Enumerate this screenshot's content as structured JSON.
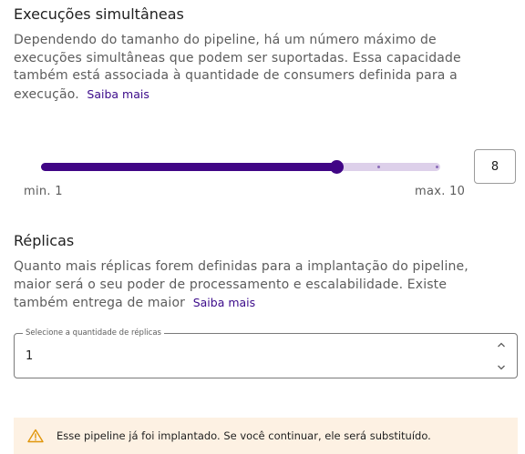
{
  "concurrency": {
    "title": "Execuções simultâneas",
    "description": "Dependendo do tamanho do pipeline, há um número máximo de execuções simultâneas que podem ser suportadas. Essa capacidade também está associada à quantidade de consumers definida para a execução.",
    "learn_more": "Saiba mais",
    "slider": {
      "min_label": "min. 1",
      "max_label": "max. 10",
      "min": 1,
      "max": 10,
      "value": 8
    },
    "value_input": "8"
  },
  "replicas": {
    "title": "Réplicas",
    "description": "Quanto mais réplicas forem definidas para a implantação do pipeline, maior será o seu poder de processamento e escalabilidade. Existe também entrega de maior",
    "learn_more": "Saiba mais",
    "select_label": "Selecione a quantidade de réplicas",
    "select_value": "1"
  },
  "alert": {
    "text": "Esse pipeline já foi implantado. Se você continuar, ele será substituído.",
    "icon": "warning-icon"
  },
  "colors": {
    "accent": "#400585",
    "track": "#ddd0ea",
    "alert_bg": "#fdf1e3",
    "warning": "#e0960a"
  }
}
